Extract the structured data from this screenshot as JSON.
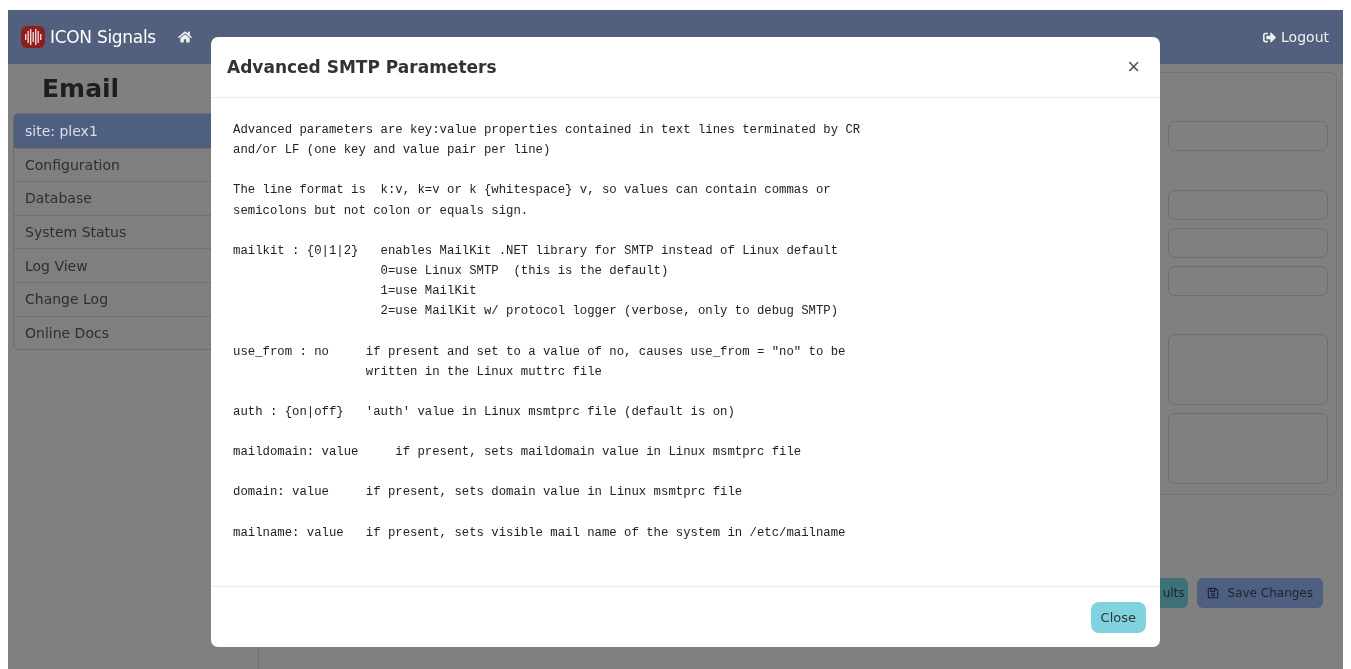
{
  "navbar": {
    "brand": "ICON Signals",
    "logout": "Logout"
  },
  "page": {
    "heading": "Email",
    "sidebar": {
      "items": [
        {
          "label": "site: plex1",
          "selected": true
        },
        {
          "label": "Configuration",
          "selected": false
        },
        {
          "label": "Database",
          "selected": false
        },
        {
          "label": "System Status",
          "selected": false
        },
        {
          "label": "Log View",
          "selected": false
        },
        {
          "label": "Change Log",
          "selected": false
        },
        {
          "label": "Online Docs",
          "selected": false
        }
      ]
    },
    "form": {
      "fields": [
        {
          "kind": "input"
        },
        {
          "kind": "input"
        },
        {
          "kind": "input"
        },
        {
          "kind": "input"
        },
        {
          "kind": "textarea"
        },
        {
          "kind": "textarea"
        }
      ],
      "buttons": [
        {
          "label": "ults",
          "kind": "secondary"
        },
        {
          "label": "Save Changes",
          "kind": "primary"
        }
      ]
    }
  },
  "modal": {
    "title": "Advanced SMTP Parameters",
    "close_symbol": "×",
    "paragraphs": [
      {
        "lines": [
          "Advanced parameters are key:value properties contained in text lines terminated by CR",
          "and/or LF (one key and value pair per line)"
        ]
      },
      {
        "lines": [
          "The line format is  k:v, k=v or k {whitespace} v, so values can contain commas or",
          "semicolons but not colon or equals sign."
        ]
      },
      {
        "lines": [
          "mailkit : {0|1|2}   enables MailKit .NET library for SMTP instead of Linux default",
          "                    0=use Linux SMTP  (this is the default)",
          "                    1=use MailKit",
          "                    2=use MailKit w/ protocol logger (verbose, only to debug SMTP)"
        ]
      },
      {
        "lines": [
          "use_from : no     if present and set to a value of no, causes use_from = \"no\" to be",
          "                  written in the Linux muttrc file"
        ]
      },
      {
        "lines": [
          "auth : {on|off}   'auth' value in Linux msmtprc file (default is on)"
        ]
      },
      {
        "lines": [
          "maildomain: value     if present, sets maildomain value in Linux msmtprc file"
        ]
      },
      {
        "lines": [
          "domain: value     if present, sets domain value in Linux msmtprc file"
        ]
      },
      {
        "lines": [
          "mailname: value   if present, sets visible mail name of the system in /etc/mailname"
        ]
      }
    ],
    "footer_button": "Close"
  }
}
